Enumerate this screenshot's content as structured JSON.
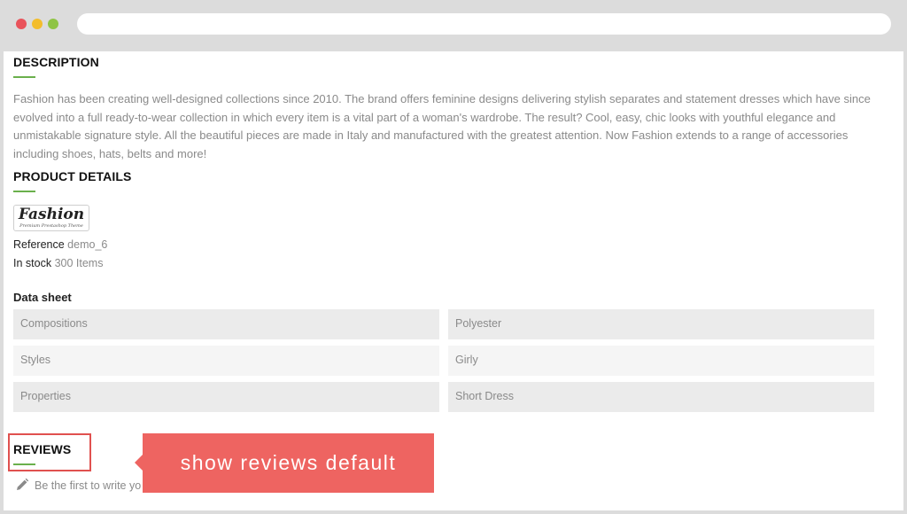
{
  "browser": {
    "controls": [
      "close",
      "minimize",
      "maximize"
    ],
    "address": ""
  },
  "description": {
    "title": "DESCRIPTION",
    "text": "Fashion has been creating well-designed collections since 2010. The brand offers feminine designs delivering stylish separates and statement dresses which have since evolved into a full ready-to-wear collection in which every item is a vital part of a woman's wardrobe. The result? Cool, easy, chic looks with youthful elegance and unmistakable signature style. All the beautiful pieces are made in Italy and manufactured with the greatest attention. Now Fashion extends to a range of accessories including shoes, hats, belts and more!"
  },
  "product_details": {
    "title": "PRODUCT DETAILS",
    "brand_logo": "Fashion",
    "brand_tagline": "Premium Prestashop Theme",
    "reference_label": "Reference",
    "reference_value": "demo_6",
    "stock_label": "In stock",
    "stock_value": "300 Items"
  },
  "data_sheet": {
    "title": "Data sheet",
    "rows": [
      {
        "name": "Compositions",
        "value": "Polyester"
      },
      {
        "name": "Styles",
        "value": "Girly"
      },
      {
        "name": "Properties",
        "value": "Short Dress"
      }
    ]
  },
  "reviews": {
    "title": "REVIEWS",
    "prompt": "Be the first to write yo",
    "icon": "pencil-icon"
  },
  "callout": {
    "text": "show reviews default"
  },
  "colors": {
    "accent_green": "#6ab04c",
    "callout_red": "#ee6461"
  }
}
